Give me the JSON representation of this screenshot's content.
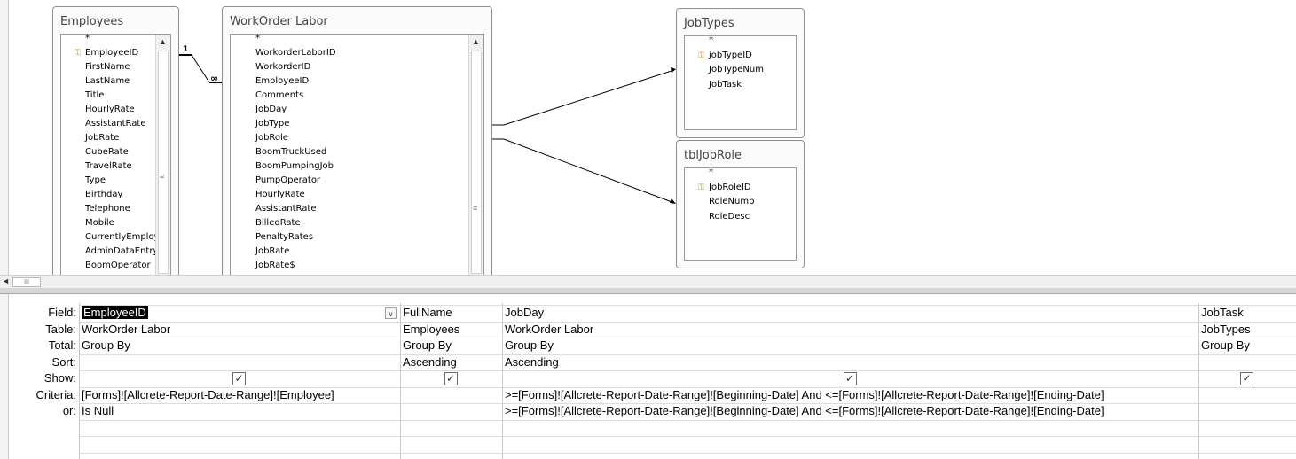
{
  "tables": {
    "employees": {
      "title": "Employees",
      "fields": [
        "*",
        "EmployeeID",
        "FirstName",
        "LastName",
        "Title",
        "HourlyRate",
        "AssistantRate",
        "JobRate",
        "CubeRate",
        "TravelRate",
        "Type",
        "Birthday",
        "Telephone",
        "Mobile",
        "CurrentlyEmploye",
        "AdminDataEntry",
        "BoomOperator"
      ]
    },
    "workorder_labor": {
      "title": "WorkOrder Labor",
      "fields": [
        "*",
        "WorkorderLaborID",
        "WorkorderID",
        "EmployeeID",
        "Comments",
        "JobDay",
        "JobType",
        "JobRole",
        "BoomTruckUsed",
        "BoomPumpingJob",
        "PumpOperator",
        "HourlyRate",
        "AssistantRate",
        "BilledRate",
        "PenaltyRates",
        "JobRate",
        "JobRate$"
      ]
    },
    "jobtypes": {
      "title": "JobTypes",
      "fields": [
        "*",
        "jobTypeID",
        "JobTypeNum",
        "JobTask"
      ]
    },
    "tbljobrole": {
      "title": "tblJobRole",
      "fields": [
        "*",
        "JobRoleID",
        "RoleNumb",
        "RoleDesc"
      ]
    }
  },
  "relationship": {
    "one": "1",
    "many": "∞"
  },
  "grid": {
    "row_labels": [
      "Field:",
      "Table:",
      "Total:",
      "Sort:",
      "Show:",
      "Criteria:",
      "or:"
    ],
    "columns": [
      {
        "field": "EmployeeID",
        "table": "WorkOrder Labor",
        "total": "Group By",
        "sort": "",
        "show": true,
        "criteria": "[Forms]![Allcrete-Report-Date-Range]![Employee]",
        "or": "Is Null"
      },
      {
        "field": "FullName",
        "table": "Employees",
        "total": "Group By",
        "sort": "Ascending",
        "show": true,
        "criteria": "",
        "or": ""
      },
      {
        "field": "JobDay",
        "table": "WorkOrder Labor",
        "total": "Group By",
        "sort": "Ascending",
        "show": true,
        "criteria": ">=[Forms]![Allcrete-Report-Date-Range]![Beginning-Date] And <=[Forms]![Allcrete-Report-Date-Range]![Ending-Date]",
        "or": ">=[Forms]![Allcrete-Report-Date-Range]![Beginning-Date] And <=[Forms]![Allcrete-Report-Date-Range]![Ending-Date]"
      },
      {
        "field": "JobTask",
        "table": "JobTypes",
        "total": "Group By",
        "sort": "",
        "show": true,
        "criteria": "",
        "or": ""
      }
    ]
  },
  "icons": {
    "key": "key-icon",
    "check": "✓",
    "scroll_up": "▲",
    "scroll_left": "◄",
    "dropdown": "∨",
    "grip": "≡",
    "hgrip": "III"
  }
}
